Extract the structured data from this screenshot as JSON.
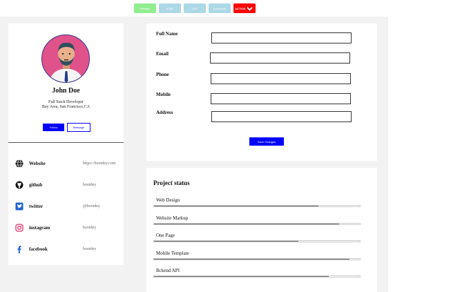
{
  "toolbar": {
    "preview": "Preview",
    "html": "HTML",
    "css": "CSS",
    "download": "Donwload",
    "action": "ACTION"
  },
  "profile": {
    "name": "John Doe",
    "role": "Full Stack Developer",
    "location": "Bay Area, San Francisco,CA",
    "follow_label": "Follow",
    "message_label": "Message"
  },
  "social": [
    {
      "label": "Website",
      "value": "https://bootdey.com",
      "icon": "globe-icon"
    },
    {
      "label": "github",
      "value": "bootdey",
      "icon": "github-icon"
    },
    {
      "label": "twitter",
      "value": "@bootdey",
      "icon": "twitter-icon"
    },
    {
      "label": "instagram",
      "value": "bootdey",
      "icon": "instagram-icon"
    },
    {
      "label": "facebook",
      "value": "bootdey",
      "icon": "facebook-icon"
    }
  ],
  "form": {
    "fields": [
      {
        "label": "Full Name",
        "value": ""
      },
      {
        "label": "Email",
        "value": ""
      },
      {
        "label": "Phone",
        "value": ""
      },
      {
        "label": "Mobile",
        "value": ""
      },
      {
        "label": "Address",
        "value": ""
      }
    ],
    "save_label": "Save Changes"
  },
  "status": {
    "title": "Project status",
    "items": [
      {
        "label": "Web Design",
        "percent": 80
      },
      {
        "label": "Website Markup",
        "percent": 90
      },
      {
        "label": "One Page",
        "percent": 70
      },
      {
        "label": "Mobile Template",
        "percent": 95
      },
      {
        "label": "Bckend API",
        "percent": 85
      }
    ]
  },
  "colors": {
    "primary": "#0000ff",
    "action": "#ff0000",
    "preview": "#90ee90",
    "tab": "#add8e6",
    "avatar_bg": "#e0528a",
    "instagram": "#e1306c",
    "twitter": "#1da1f2",
    "facebook": "#1877f2"
  }
}
